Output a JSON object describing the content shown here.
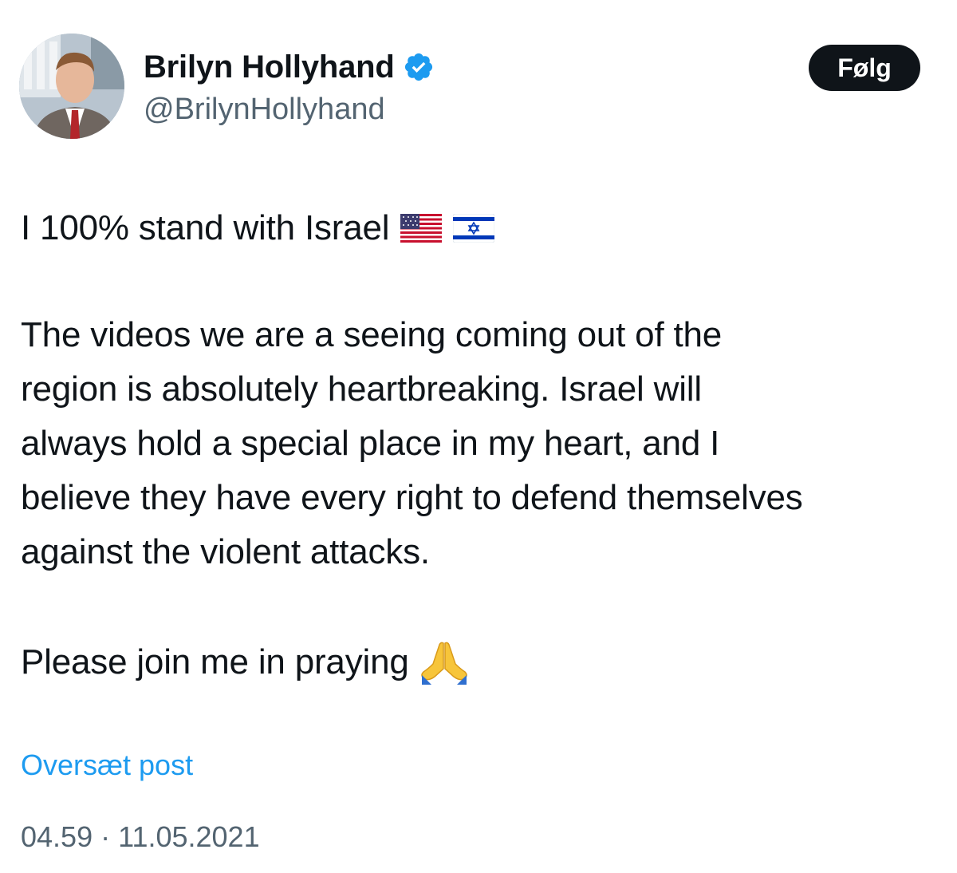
{
  "author": {
    "display_name": "Brilyn Hollyhand",
    "handle": "@BrilynHollyhand",
    "verified": true,
    "verified_color": "#1d9bf0"
  },
  "follow_label": "Følg",
  "post": {
    "line1": "I 100% stand with Israel",
    "line1_emojis": [
      "flag-us-icon",
      "flag-israel-icon"
    ],
    "paragraph2_lines": [
      "The videos we are a seeing coming out of the",
      "region is absolutely heartbreaking. Israel will",
      "always hold a special place in my heart, and I",
      "believe they have every right to defend themselves",
      "against the violent attacks."
    ],
    "line3": "Please join me in praying",
    "line3_emoji": "praying-hands-icon"
  },
  "translate_label": "Oversæt post",
  "timestamp": {
    "time": "04.59",
    "separator": "·",
    "date": "11.05.2021"
  },
  "colors": {
    "text": "#0f1419",
    "secondary": "#536471",
    "link": "#1d9bf0",
    "button_bg": "#0f1419"
  }
}
